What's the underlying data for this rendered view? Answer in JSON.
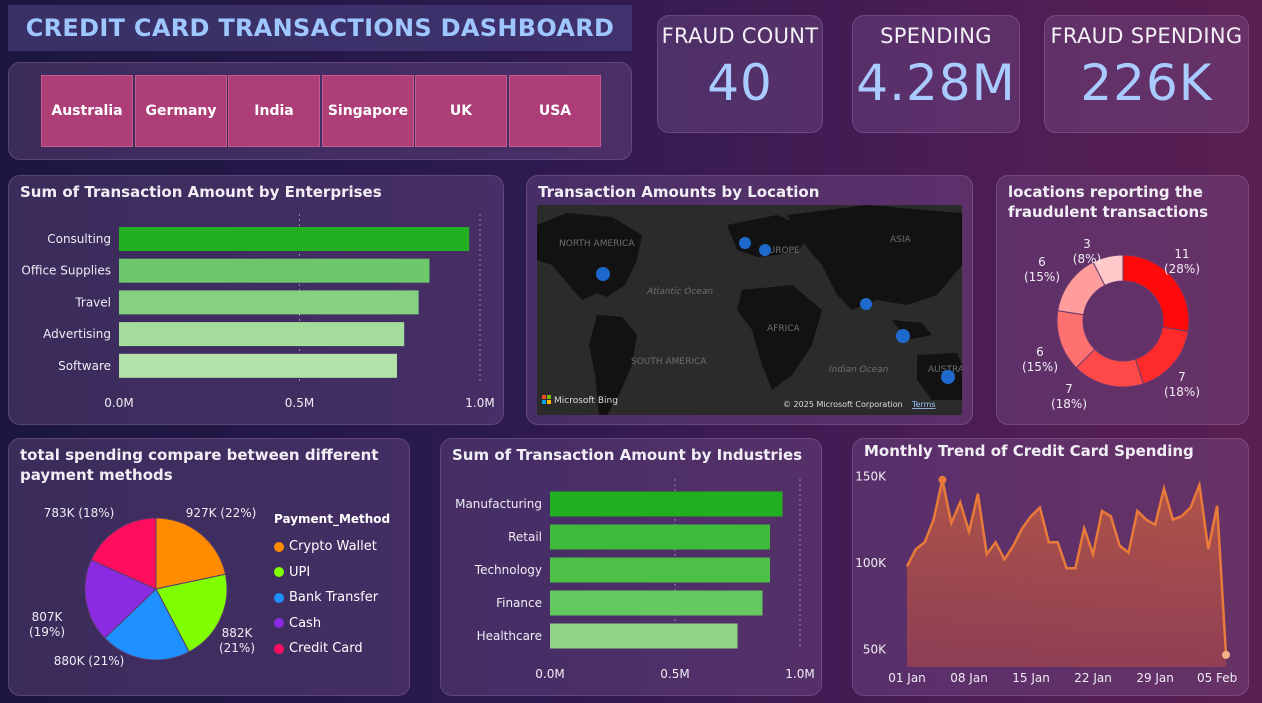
{
  "header": {
    "title": "CREDIT CARD TRANSACTIONS DASHBOARD"
  },
  "slicer": {
    "countries": [
      "Australia",
      "Germany",
      "India",
      "Singapore",
      "UK",
      "USA"
    ]
  },
  "kpis": [
    {
      "label": "FRAUD COUNT",
      "value": "40"
    },
    {
      "label": "SPENDING",
      "value": "4.28M"
    },
    {
      "label": "FRAUD SPENDING",
      "value": "226K"
    }
  ],
  "colors": {
    "accent_text": "#a9cbff",
    "slicer_button": "#ad3e78",
    "bar_dark_green": "#22b022",
    "area_line": "#e87a3a"
  },
  "map": {
    "title": "Transaction Amounts by Location",
    "labels": [
      "NORTH AMERICA",
      "EUROPE",
      "ASIA",
      "Atlantic Ocean",
      "AFRICA",
      "SOUTH AMERICA",
      "Indian Ocean",
      "AUSTRA"
    ],
    "brand": "Microsoft Bing",
    "copyright": "© 2025 Microsoft Corporation",
    "terms": "Terms"
  },
  "chart_data": [
    {
      "type": "bar",
      "orientation": "horizontal",
      "title": "Sum of Transaction Amount by Enterprises",
      "categories": [
        "Consulting",
        "Office Supplies",
        "Travel",
        "Advertising",
        "Software"
      ],
      "values": [
        0.97,
        0.86,
        0.83,
        0.79,
        0.77
      ],
      "unit": "M",
      "xlim": [
        0,
        1.0
      ],
      "xticks": [
        "0.0M",
        "0.5M",
        "1.0M"
      ],
      "colors": [
        "#22b022",
        "#6cc86a",
        "#86d082",
        "#a4dc9c",
        "#b3e3aa"
      ]
    },
    {
      "type": "pie",
      "donut": true,
      "title": "locations reporting the fraudulent transactions",
      "labels": [
        "11 (28%)",
        "7 (18%)",
        "7 (18%)",
        "6 (15%)",
        "6 (15%)",
        "3 (8%)"
      ],
      "values": [
        11,
        7,
        7,
        6,
        6,
        3
      ],
      "colors": [
        "#ff0a0a",
        "#ff2b2b",
        "#ff4848",
        "#ff7070",
        "#ff9c9c",
        "#ffc9c9"
      ]
    },
    {
      "type": "pie",
      "title": "total spending compare between different payment methods",
      "legend_title": "Payment_Method",
      "categories": [
        "Crypto Wallet",
        "UPI",
        "Bank Transfer",
        "Cash",
        "Credit Card"
      ],
      "values": [
        927,
        882,
        880,
        807,
        783
      ],
      "labels": [
        "927K (22%)",
        "882K (21%)",
        "880K (21%)",
        "807K (19%)",
        "783K (18%)"
      ],
      "colors": [
        "#ff8c00",
        "#7fff00",
        "#1e90ff",
        "#8a2be2",
        "#ff0d5e"
      ]
    },
    {
      "type": "bar",
      "orientation": "horizontal",
      "title": "Sum of Transaction Amount by Industries",
      "categories": [
        "Manufacturing",
        "Retail",
        "Technology",
        "Finance",
        "Healthcare"
      ],
      "values": [
        0.93,
        0.88,
        0.88,
        0.85,
        0.75
      ],
      "unit": "M",
      "xlim": [
        0,
        1.0
      ],
      "xticks": [
        "0.0M",
        "0.5M",
        "1.0M"
      ],
      "colors": [
        "#22b022",
        "#3ebb3a",
        "#4cc047",
        "#64c95f",
        "#8fd386"
      ]
    },
    {
      "type": "area",
      "title": "Monthly Trend of Credit Card Spending",
      "x_start": "01 Jan",
      "x_end": "05 Feb",
      "xticks": [
        "01 Jan",
        "08 Jan",
        "15 Jan",
        "22 Jan",
        "29 Jan",
        "05 Feb"
      ],
      "ylim": [
        40,
        160
      ],
      "yticks": [
        "150K",
        "100K",
        "50K"
      ],
      "unit": "K",
      "values": [
        98,
        108,
        112,
        125,
        148,
        123,
        135,
        118,
        140,
        105,
        112,
        102,
        110,
        120,
        127,
        132,
        112,
        112,
        97,
        97,
        120,
        105,
        130,
        127,
        110,
        106,
        130,
        125,
        122,
        143,
        125,
        127,
        132,
        145,
        108,
        133,
        47
      ]
    }
  ]
}
